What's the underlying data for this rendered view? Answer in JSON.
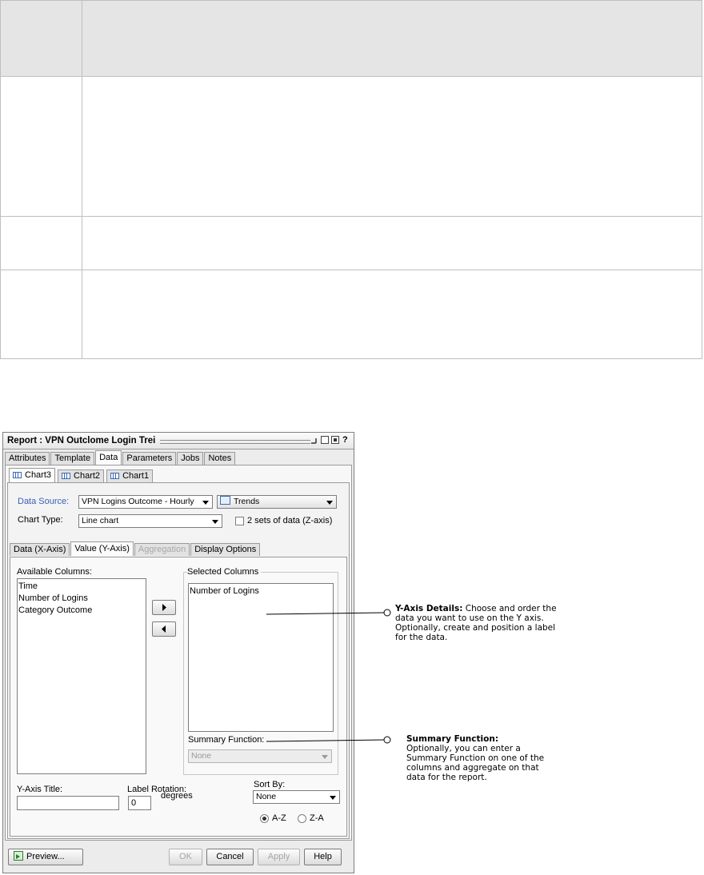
{
  "dialog": {
    "title": "Report : VPN Outclome Login Trei",
    "main_tabs": [
      "Attributes",
      "Template",
      "Data",
      "Parameters",
      "Jobs",
      "Notes"
    ],
    "chart_tabs": [
      "Chart3",
      "Chart2",
      "Chart1"
    ],
    "data_source_label": "Data Source:",
    "data_source_value": "VPN Logins Outcome - Hourly",
    "trends_value": "Trends",
    "chart_type_label": "Chart Type:",
    "chart_type_value": "Line chart",
    "z_axis_label": "2 sets of data (Z-axis)",
    "sub_tabs": [
      "Data (X-Axis)",
      "Value (Y-Axis)",
      "Aggregation",
      "Display Options"
    ],
    "available_columns_label": "Available Columns:",
    "available_columns": [
      "Time",
      "Number of Logins",
      "Category Outcome"
    ],
    "selected_columns_label": "Selected Columns",
    "selected_columns": [
      "Number of Logins"
    ],
    "summary_function_label": "Summary Function:",
    "summary_function_value": "None",
    "y_axis_title_label": "Y-Axis Title:",
    "y_axis_title_value": "",
    "label_rotation_label": "Label Rotation:",
    "label_rotation_value": "0",
    "degrees_label": "degrees",
    "sort_by_label": "Sort By:",
    "sort_by_value": "None",
    "sort_az": "A-Z",
    "sort_za": "Z-A",
    "preview_label": "Preview...",
    "ok_label": "OK",
    "cancel_label": "Cancel",
    "apply_label": "Apply",
    "help_label": "Help"
  },
  "annotations": {
    "y_axis": {
      "title": "Y-Axis Details:",
      "text": "Choose and order the data you want to use on the Y axis. Optionally, create and position a label for the data."
    },
    "summary": {
      "title": "Summary Function:",
      "text": "Optionally, you can enter a Summary Function on one of the columns and aggregate on that data for the report."
    }
  },
  "colors": {
    "line": "#000000",
    "label_blue": "#3b5fb8",
    "table_header": "#e5e5e5"
  }
}
